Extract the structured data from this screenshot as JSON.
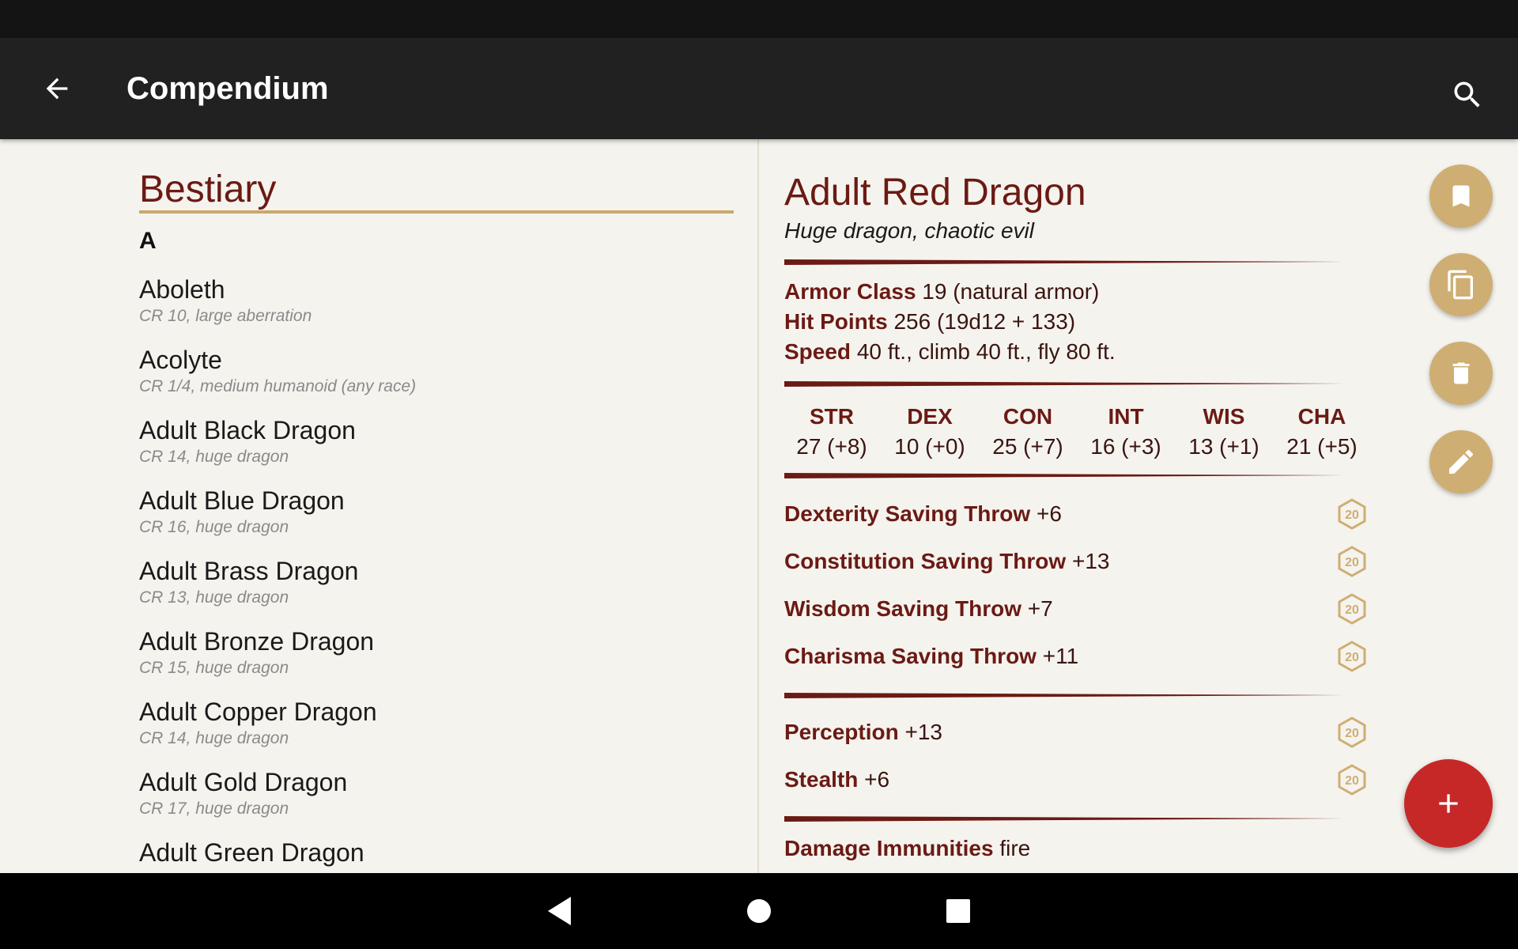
{
  "appbar": {
    "title": "Compendium"
  },
  "list": {
    "section_title": "Bestiary",
    "letter": "A",
    "items": [
      {
        "name": "Aboleth",
        "sub": "CR 10, large aberration"
      },
      {
        "name": "Acolyte",
        "sub": "CR 1/4, medium humanoid (any race)"
      },
      {
        "name": "Adult Black Dragon",
        "sub": "CR 14, huge dragon"
      },
      {
        "name": "Adult Blue Dragon",
        "sub": "CR 16, huge dragon"
      },
      {
        "name": "Adult Brass Dragon",
        "sub": "CR 13, huge dragon"
      },
      {
        "name": "Adult Bronze Dragon",
        "sub": "CR 15, huge dragon"
      },
      {
        "name": "Adult Copper Dragon",
        "sub": "CR 14, huge dragon"
      },
      {
        "name": "Adult Gold Dragon",
        "sub": "CR 17, huge dragon"
      },
      {
        "name": "Adult Green Dragon",
        "sub": ""
      }
    ]
  },
  "detail": {
    "name": "Adult Red Dragon",
    "subtitle": "Huge dragon, chaotic evil",
    "armor_class": {
      "label": "Armor Class",
      "value": "19 (natural armor)"
    },
    "hit_points": {
      "label": "Hit Points",
      "value": "256 (19d12 + 133)"
    },
    "speed": {
      "label": "Speed",
      "value": "40 ft., climb 40 ft., fly 80 ft."
    },
    "abilities": [
      {
        "name": "STR",
        "value": "27 (+8)"
      },
      {
        "name": "DEX",
        "value": "10 (+0)"
      },
      {
        "name": "CON",
        "value": "25 (+7)"
      },
      {
        "name": "INT",
        "value": "16 (+3)"
      },
      {
        "name": "WIS",
        "value": "13 (+1)"
      },
      {
        "name": "CHA",
        "value": "21 (+5)"
      }
    ],
    "saving_throws": [
      {
        "label": "Dexterity Saving Throw",
        "value": "+6"
      },
      {
        "label": "Constitution Saving Throw",
        "value": "+13"
      },
      {
        "label": "Wisdom Saving Throw",
        "value": "+7"
      },
      {
        "label": "Charisma Saving Throw",
        "value": "+11"
      }
    ],
    "skills": [
      {
        "label": "Perception",
        "value": "+13"
      },
      {
        "label": "Stealth",
        "value": "+6"
      }
    ],
    "damage_immunities": {
      "label": "Damage Immunities",
      "value": "fire"
    },
    "d20_label": "20"
  },
  "colors": {
    "accent_dark_red": "#6b1a14",
    "gold": "#cfae73",
    "fab_red": "#c62828",
    "appbar": "#212121"
  },
  "icons": {
    "back": "arrow-left-icon",
    "search": "search-icon",
    "bookmark": "bookmark-icon",
    "copy": "copy-icon",
    "delete": "trash-icon",
    "edit": "pencil-icon",
    "add": "plus-icon",
    "dice": "d20-icon"
  }
}
